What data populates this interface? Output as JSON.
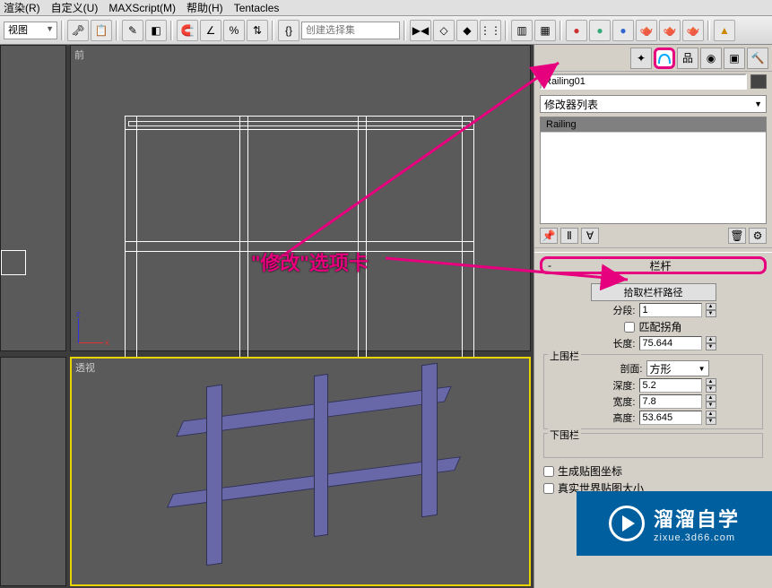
{
  "menu": {
    "items": [
      "渲染(R)",
      "自定义(U)",
      "MAXScript(M)",
      "帮助(H)",
      "Tentacles"
    ]
  },
  "toolbar": {
    "view_dd": "视图",
    "selset_placeholder": "创建选择集"
  },
  "viewports": {
    "front": "前",
    "perspective": "透视"
  },
  "panel": {
    "tabs_hint": "Modify",
    "object_name": "Railing01",
    "mod_list_dd": "修改器列表",
    "mod_stack_item": " Railing",
    "rollout_rail": {
      "title": "栏杆",
      "pick_path": "拾取栏杆路径",
      "segments_label": "分段:",
      "segments_value": "1",
      "match_corners": "匹配拐角",
      "length_label": "长度:",
      "length_value": "75.644",
      "top_group": "上围栏",
      "profile_label": "剖面:",
      "profile_value": "方形",
      "depth_label": "深度:",
      "depth_value": "5.2",
      "width_label": "宽度:",
      "width_value": "7.8",
      "height_label": "高度:",
      "height_value": "53.645",
      "bottom_group": "下围栏",
      "gen_mapping": "生成贴图坐标",
      "real_world": "真实世界贴图大小"
    }
  },
  "callout": {
    "text": "\"修改\"选项卡"
  },
  "watermark": {
    "title": "溜溜自学",
    "sub": "zixue.3d66.com"
  }
}
